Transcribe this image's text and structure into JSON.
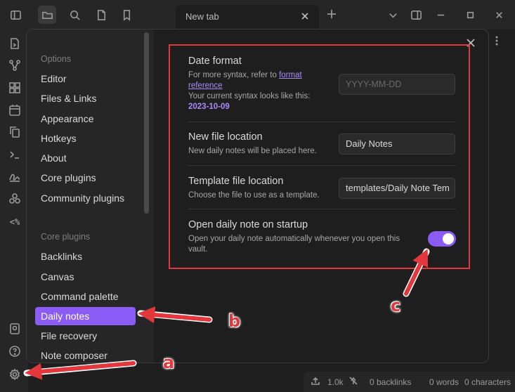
{
  "top_bar": {
    "tab_title": "New tab",
    "icons": [
      "sidebar-toggle-icon",
      "folder-icon",
      "search-icon",
      "file-icon",
      "bookmark-icon",
      "chevron-down-icon",
      "split-layout-icon",
      "minimize-icon",
      "maximize-icon",
      "close-icon"
    ]
  },
  "ribbon": {
    "icons": [
      "open-quick-switcher-icon",
      "graph-icon",
      "canvas-icon",
      "calendar-icon",
      "copy-icon",
      "terminal-icon",
      "signature-icon",
      "plugins-icon",
      "code-icon",
      "vault-icon",
      "help-icon",
      "settings-icon"
    ],
    "code_label": "<%"
  },
  "settings_nav": {
    "options_header": "Options",
    "options_items": [
      "Editor",
      "Files & Links",
      "Appearance",
      "Hotkeys",
      "About",
      "Core plugins",
      "Community plugins"
    ],
    "core_header": "Core plugins",
    "core_items": [
      "Backlinks",
      "Canvas",
      "Command palette",
      "Daily notes",
      "File recovery",
      "Note composer"
    ],
    "active_item": "Daily notes"
  },
  "settings": {
    "date_format": {
      "name": "Date format",
      "desc_prefix": "For more syntax, refer to ",
      "link_text": "format reference",
      "current_prefix": "Your current syntax looks like this:",
      "current_value": "2023-10-09",
      "placeholder": "YYYY-MM-DD"
    },
    "new_file_location": {
      "name": "New file location",
      "desc": "New daily notes will be placed here.",
      "value": "Daily Notes"
    },
    "template_file_location": {
      "name": "Template file location",
      "desc": "Choose the file to use as a template.",
      "value": "templates/Daily Note Tem"
    },
    "open_on_startup": {
      "name": "Open daily note on startup",
      "desc": "Open your daily note automatically whenever you open this vault.",
      "enabled": true
    }
  },
  "status_bar": {
    "count": "1.0k",
    "backlinks": "0 backlinks",
    "words": "0 words",
    "characters": "0 characters"
  },
  "annotations": {
    "a": "a",
    "b": "b",
    "c": "c",
    "color": "#e2373d"
  },
  "colors": {
    "accent": "#8a5cf5",
    "annotation": "#e2373d",
    "background": "#1e1e1e"
  }
}
